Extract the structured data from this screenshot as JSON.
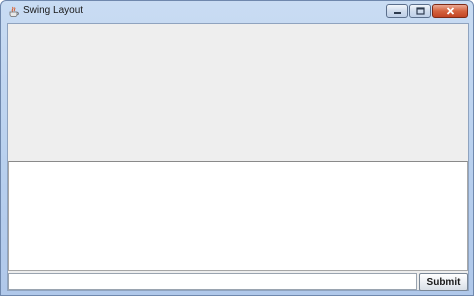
{
  "window": {
    "title": "Swing Layout",
    "icon": "java-cup-icon",
    "controls": {
      "minimize": "minimize-icon",
      "maximize": "maximize-icon",
      "close": "close-icon"
    }
  },
  "form": {
    "text_area_value": "",
    "input_value": "",
    "submit_label": "Submit"
  },
  "colors": {
    "panel_background": "#eeeeee",
    "text_area_background": "#ffffff",
    "close_button": "#c9502c"
  }
}
